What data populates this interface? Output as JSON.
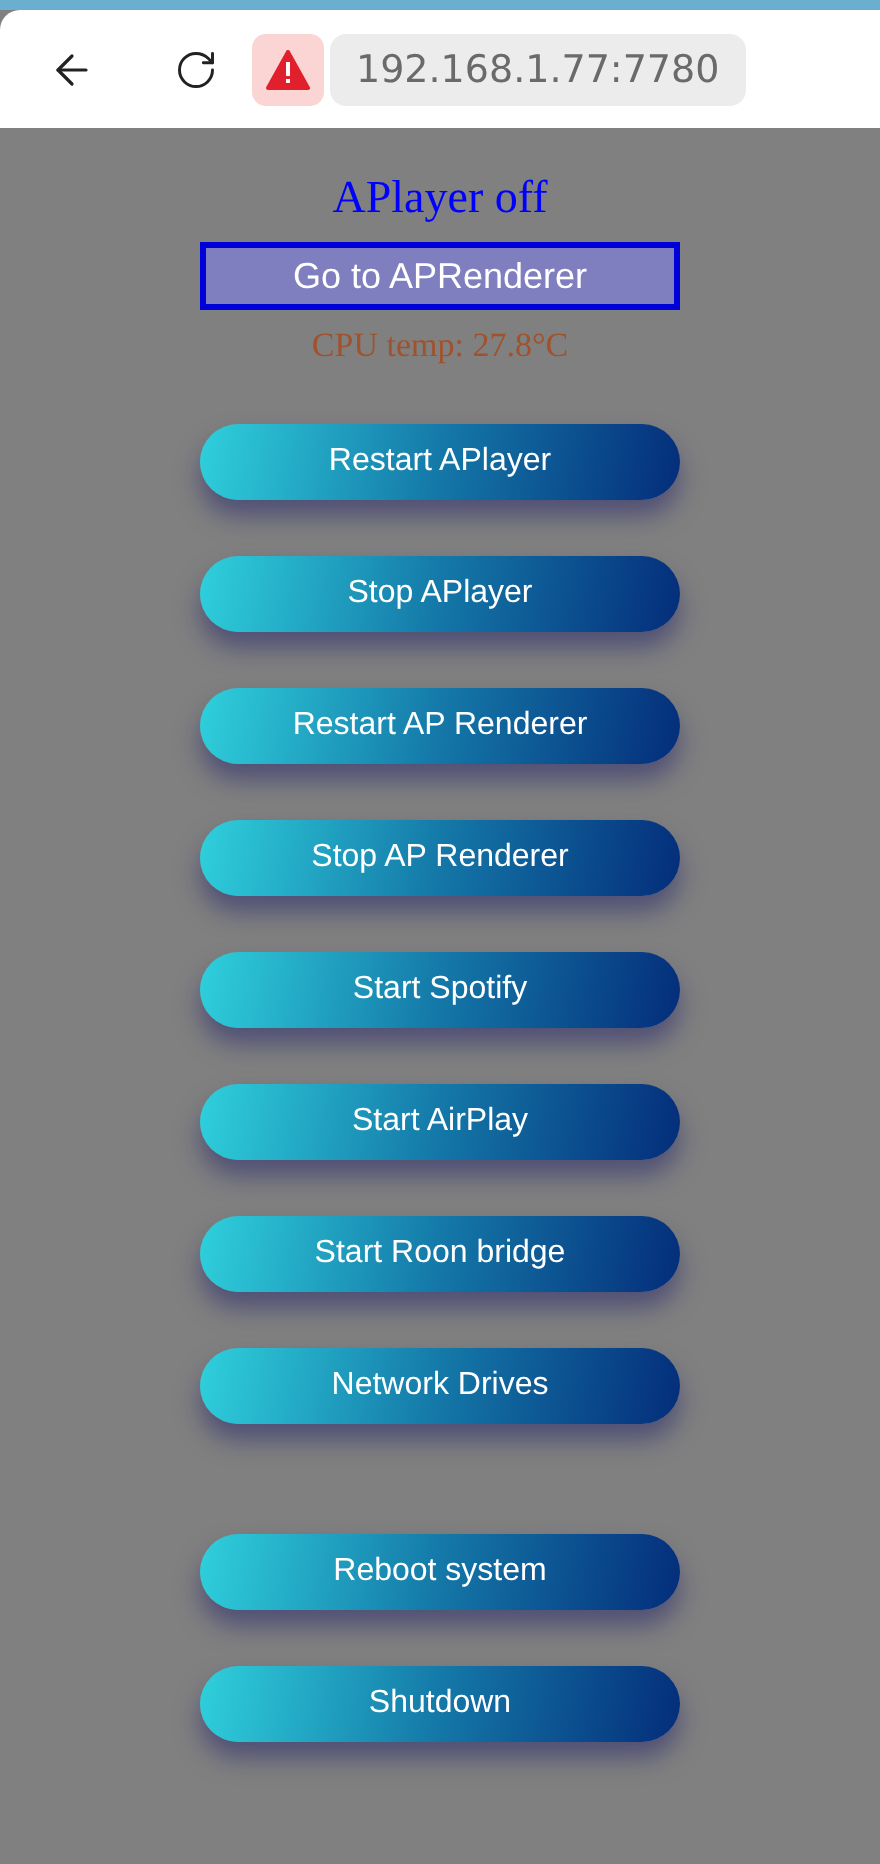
{
  "browser": {
    "url": "192.168.1.77:7780"
  },
  "status": {
    "text": "APlayer off"
  },
  "link_button": {
    "label": "Go to APRenderer"
  },
  "cpu_temp": "CPU temp: 27.8°C",
  "button_groups": [
    [
      "Restart APlayer",
      "Stop APlayer",
      "Restart AP Renderer",
      "Stop AP Renderer",
      "Start Spotify",
      "Start AirPlay",
      "Start Roon bridge",
      "Network Drives"
    ],
    [
      "Reboot system",
      "Shutdown"
    ]
  ]
}
